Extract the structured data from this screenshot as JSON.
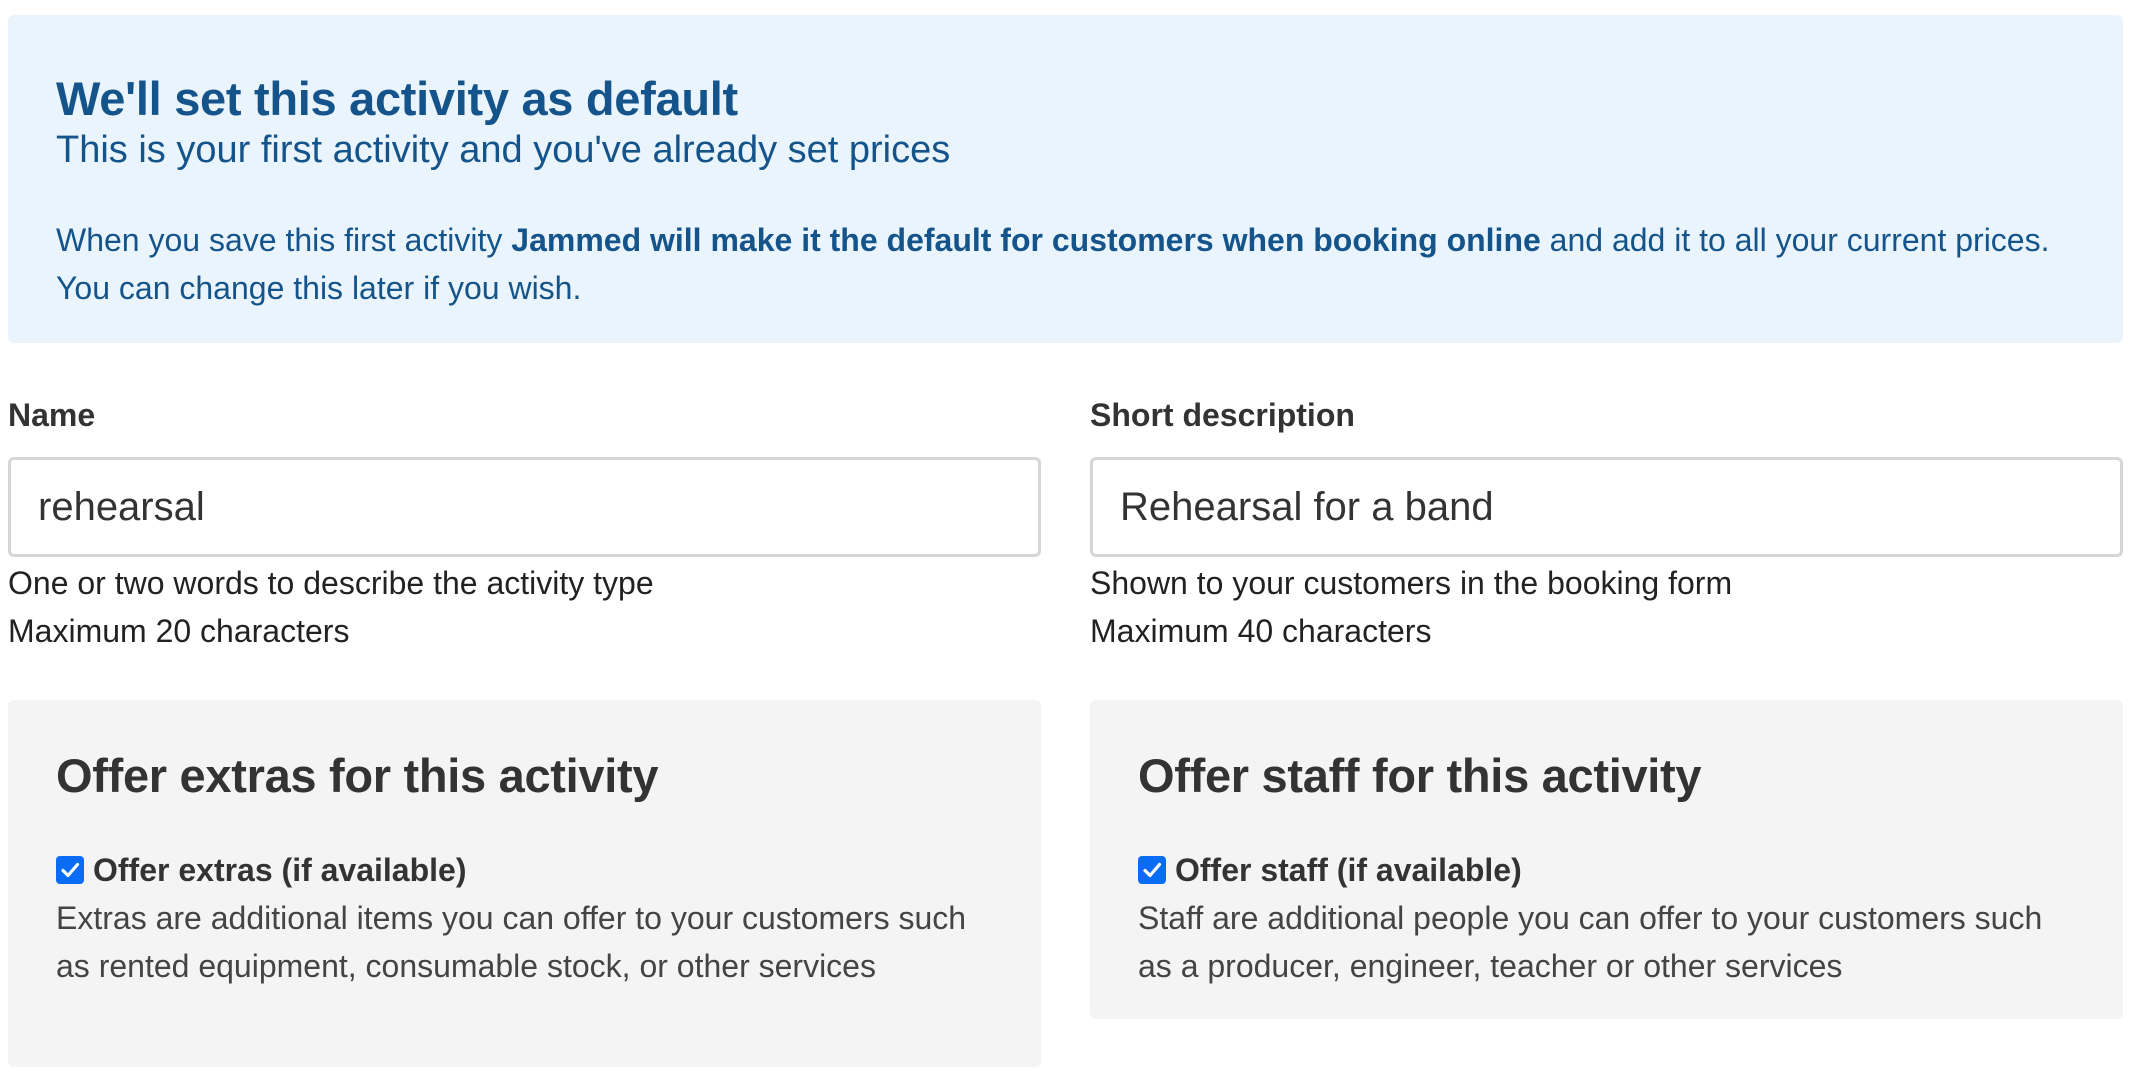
{
  "banner": {
    "title": "We'll set this activity as default",
    "subtitle": "This is your first activity and you've already set prices",
    "body_prefix": "When you save this first activity ",
    "body_bold": "Jammed will make it the default for customers when booking online",
    "body_suffix": " and add it to all your current prices. You can change this later if you wish.",
    "colors": {
      "background": "#eaf4fc",
      "text": "#14548a"
    }
  },
  "fields": {
    "name": {
      "label": "Name",
      "value": "rehearsal",
      "help_line1": "One or two words to describe the activity type",
      "help_line2": "Maximum 20 characters"
    },
    "short_description": {
      "label": "Short description",
      "value": "Rehearsal for a band",
      "help_line1": "Shown to your customers in the booking form",
      "help_line2": "Maximum 40 characters"
    }
  },
  "extras_card": {
    "title": "Offer extras for this activity",
    "checkbox_label": "Offer extras (if available)",
    "checked": true,
    "description": "Extras are additional items you can offer to your customers such as rented equipment, consumable stock, or other services"
  },
  "staff_card": {
    "title": "Offer staff for this activity",
    "checkbox_label": "Offer staff (if available)",
    "checked": true,
    "description": "Staff are additional people you can offer to your customers such as a producer, engineer, teacher or other services"
  },
  "icons": {
    "checkbox": "checkmark-icon"
  },
  "colors": {
    "checkbox_accent": "#0a6cf5",
    "card_background": "#f4f4f4"
  }
}
